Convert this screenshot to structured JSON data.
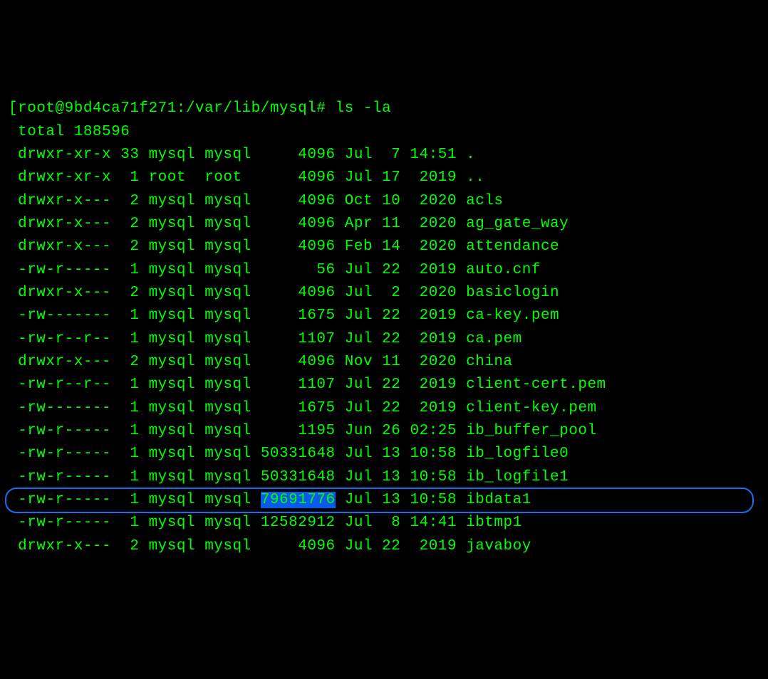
{
  "prompt": {
    "open_bracket": "[",
    "user_host_path": "root@9bd4ca71f271:/var/lib/mysql#",
    "command": "ls -la"
  },
  "total_line": "total 188596",
  "rows": [
    {
      "perm": "drwxr-xr-x",
      "links": "33",
      "owner": "mysql",
      "group": "mysql",
      "size": "4096",
      "month": "Jul",
      "day": "7",
      "time": "14:51",
      "name": "."
    },
    {
      "perm": "drwxr-xr-x",
      "links": "1",
      "owner": "root",
      "group": "root",
      "size": "4096",
      "month": "Jul",
      "day": "17",
      "time": "2019",
      "name": ".."
    },
    {
      "perm": "drwxr-x---",
      "links": "2",
      "owner": "mysql",
      "group": "mysql",
      "size": "4096",
      "month": "Oct",
      "day": "10",
      "time": "2020",
      "name": "acls"
    },
    {
      "perm": "drwxr-x---",
      "links": "2",
      "owner": "mysql",
      "group": "mysql",
      "size": "4096",
      "month": "Apr",
      "day": "11",
      "time": "2020",
      "name": "ag_gate_way"
    },
    {
      "perm": "drwxr-x---",
      "links": "2",
      "owner": "mysql",
      "group": "mysql",
      "size": "4096",
      "month": "Feb",
      "day": "14",
      "time": "2020",
      "name": "attendance"
    },
    {
      "perm": "-rw-r-----",
      "links": "1",
      "owner": "mysql",
      "group": "mysql",
      "size": "56",
      "month": "Jul",
      "day": "22",
      "time": "2019",
      "name": "auto.cnf"
    },
    {
      "perm": "drwxr-x---",
      "links": "2",
      "owner": "mysql",
      "group": "mysql",
      "size": "4096",
      "month": "Jul",
      "day": "2",
      "time": "2020",
      "name": "basiclogin"
    },
    {
      "perm": "-rw-------",
      "links": "1",
      "owner": "mysql",
      "group": "mysql",
      "size": "1675",
      "month": "Jul",
      "day": "22",
      "time": "2019",
      "name": "ca-key.pem"
    },
    {
      "perm": "-rw-r--r--",
      "links": "1",
      "owner": "mysql",
      "group": "mysql",
      "size": "1107",
      "month": "Jul",
      "day": "22",
      "time": "2019",
      "name": "ca.pem"
    },
    {
      "perm": "drwxr-x---",
      "links": "2",
      "owner": "mysql",
      "group": "mysql",
      "size": "4096",
      "month": "Nov",
      "day": "11",
      "time": "2020",
      "name": "china"
    },
    {
      "perm": "-rw-r--r--",
      "links": "1",
      "owner": "mysql",
      "group": "mysql",
      "size": "1107",
      "month": "Jul",
      "day": "22",
      "time": "2019",
      "name": "client-cert.pem"
    },
    {
      "perm": "-rw-------",
      "links": "1",
      "owner": "mysql",
      "group": "mysql",
      "size": "1675",
      "month": "Jul",
      "day": "22",
      "time": "2019",
      "name": "client-key.pem"
    },
    {
      "perm": "-rw-r-----",
      "links": "1",
      "owner": "mysql",
      "group": "mysql",
      "size": "1195",
      "month": "Jun",
      "day": "26",
      "time": "02:25",
      "name": "ib_buffer_pool"
    },
    {
      "perm": "-rw-r-----",
      "links": "1",
      "owner": "mysql",
      "group": "mysql",
      "size": "50331648",
      "month": "Jul",
      "day": "13",
      "time": "10:58",
      "name": "ib_logfile0"
    },
    {
      "perm": "-rw-r-----",
      "links": "1",
      "owner": "mysql",
      "group": "mysql",
      "size": "50331648",
      "month": "Jul",
      "day": "13",
      "time": "10:58",
      "name": "ib_logfile1"
    },
    {
      "perm": "-rw-r-----",
      "links": "1",
      "owner": "mysql",
      "group": "mysql",
      "size": "79691776",
      "month": "Jul",
      "day": "13",
      "time": "10:58",
      "name": "ibdata1",
      "highlighted": true,
      "size_selected": true
    },
    {
      "perm": "-rw-r-----",
      "links": "1",
      "owner": "mysql",
      "group": "mysql",
      "size": "12582912",
      "month": "Jul",
      "day": "8",
      "time": "14:41",
      "name": "ibtmp1"
    },
    {
      "perm": "drwxr-x---",
      "links": "2",
      "owner": "mysql",
      "group": "mysql",
      "size": "4096",
      "month": "Jul",
      "day": "22",
      "time": "2019",
      "name": "javaboy"
    }
  ]
}
